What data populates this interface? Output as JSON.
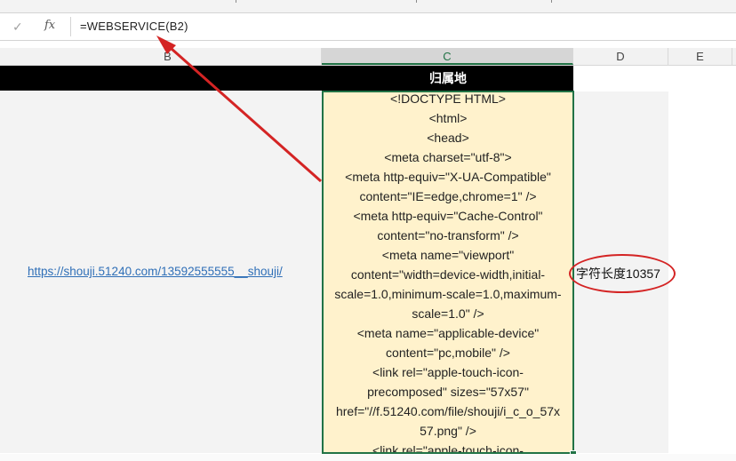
{
  "formula_bar": {
    "check_glyph": "✓",
    "fx_label": "fx",
    "formula": "=WEBSERVICE(B2)"
  },
  "columns": [
    "B",
    "C",
    "D",
    "E"
  ],
  "title_row": {
    "c_header": "归属地"
  },
  "cell_b2": {
    "link": "https://shouji.51240.com/13592555555__shouji/"
  },
  "cell_c2": {
    "lines": [
      "<!DOCTYPE HTML>",
      "<html>",
      "<head>",
      "<meta charset=\"utf-8\">",
      "<meta http-equiv=\"X-UA-Compatible\"",
      "content=\"IE=edge,chrome=1\" />",
      "<meta http-equiv=\"Cache-Control\"",
      "content=\"no-transform\" />",
      "<meta name=\"viewport\"",
      "content=\"width=device-width,initial-",
      "scale=1.0,minimum-scale=1.0,maximum-",
      "scale=1.0\" />",
      "<meta name=\"applicable-device\"",
      "content=\"pc,mobile\" />",
      "<link rel=\"apple-touch-icon-",
      "precomposed\" sizes=\"57x57\"",
      "href=\"//f.51240.com/file/shouji/i_c_o_57x",
      "57.png\" />",
      "<link rel=\"apple-touch-icon-"
    ]
  },
  "cell_d2": {
    "text": "字符长度10357"
  },
  "annotation_color": "#d42424",
  "selection_color": "#217346"
}
